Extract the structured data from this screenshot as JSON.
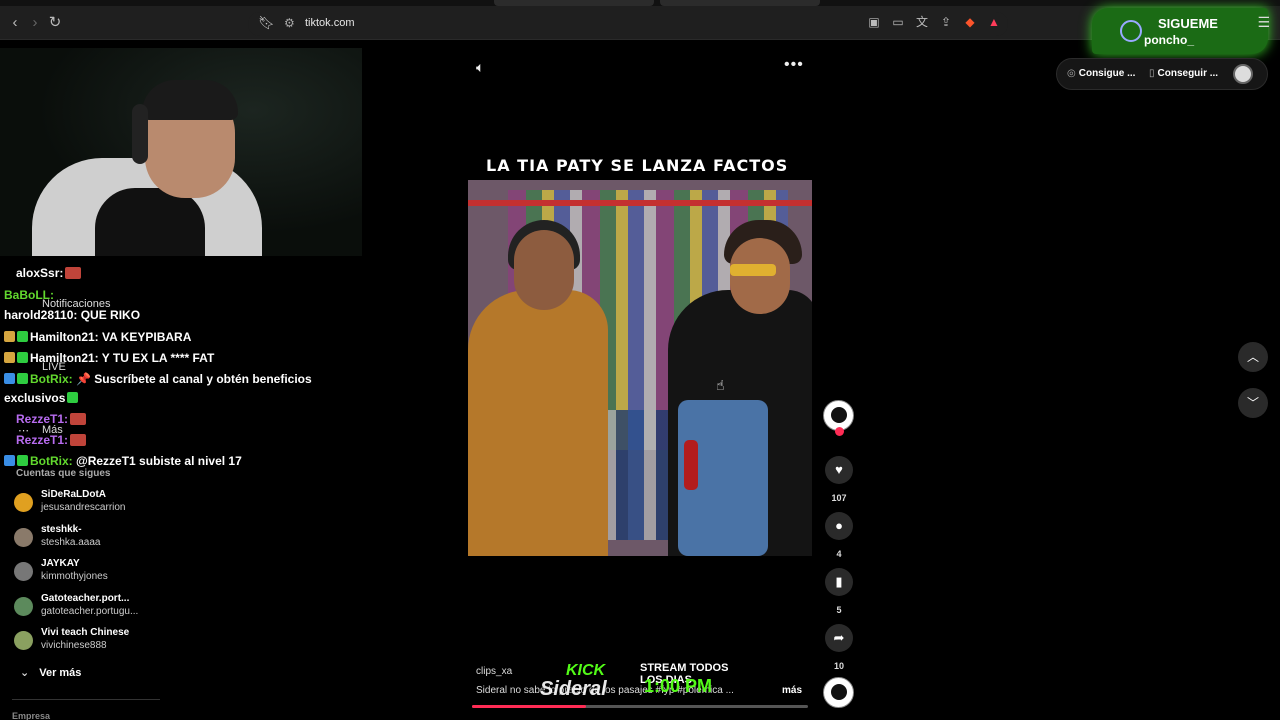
{
  "browser": {
    "url": "tiktok.com"
  },
  "overlay": {
    "sigueme_label": "SIGUEME",
    "sigueme_handle": "poncho_"
  },
  "top_pills": {
    "coins_label": "Consigue ...",
    "app_label": "Conseguir ..."
  },
  "sidebar": {
    "notifications": "Notificaciones",
    "live": "LIVE",
    "more": "Más",
    "following_header": "Cuentas que sigues",
    "following": [
      {
        "name": "SiDeRaLDotA",
        "handle": "jesusandrescarrion",
        "color": "#e0a020"
      },
      {
        "name": "steshkk-",
        "handle": "steshka.aaaa",
        "color": "#8a7a6a"
      },
      {
        "name": "JAYKAY",
        "handle": "kimmothyjones",
        "color": "#777777"
      },
      {
        "name": "Gatoteacher.port...",
        "handle": "gatoteacher.portugu...",
        "color": "#5c8a5c"
      },
      {
        "name": "Vivi teach Chinese",
        "handle": "vivichinese888",
        "color": "#8aa060"
      }
    ],
    "see_more": "Ver más",
    "company": "Empresa"
  },
  "chat": [
    {
      "user": "aloxSsr:",
      "color": "#ffffff",
      "msg": "",
      "emote": true
    },
    {
      "user": "BaBoLL:",
      "color": "#62d92e",
      "msg": "",
      "emote": false
    },
    {
      "user": "harold28110:",
      "color": "#ffffff",
      "msg": " QUE RIKO",
      "emote": false
    },
    {
      "user": "Hamilton21:",
      "color": "#ffffff",
      "msg": " VA KEYPIBARA",
      "emote": false
    },
    {
      "user": "Hamilton21:",
      "color": "#ffffff",
      "msg": " Y TU EX LA **** FAT",
      "emote": false
    },
    {
      "user": "BotRix:",
      "color": "#62d92e",
      "msg": " 📌 Suscríbete al canal y obtén beneficios",
      "emote": false
    },
    {
      "user": "",
      "color": "#ffffff",
      "msg": "exclusivos",
      "emote": false
    },
    {
      "user": "RezzeT1:",
      "color": "#b86cf0",
      "msg": "",
      "emote": true
    },
    {
      "user": "RezzeT1:",
      "color": "#b86cf0",
      "msg": "",
      "emote": true
    },
    {
      "user": "BotRix:",
      "color": "#62d92e",
      "msg": " @RezzeT1 subiste al nivel 17",
      "emote": false
    }
  ],
  "video": {
    "title": "LA TIA PATY SE LANZA FACTOS",
    "author": "clips_xa",
    "caption": "Sideral no sabe lo precio de los pasajes  #fyp  #polemica  ...",
    "more": "más",
    "progress": 0.34,
    "likes": "107",
    "comments": "4",
    "saves": "5",
    "shares": "10"
  },
  "kick": {
    "brand": "KICK",
    "line1": "STREAM TODOS LOS DIAS",
    "line2": "1:00 PM",
    "name": "Sideral"
  },
  "colors": {
    "accent": "#ff2c55",
    "kick_green": "#53fc18"
  }
}
